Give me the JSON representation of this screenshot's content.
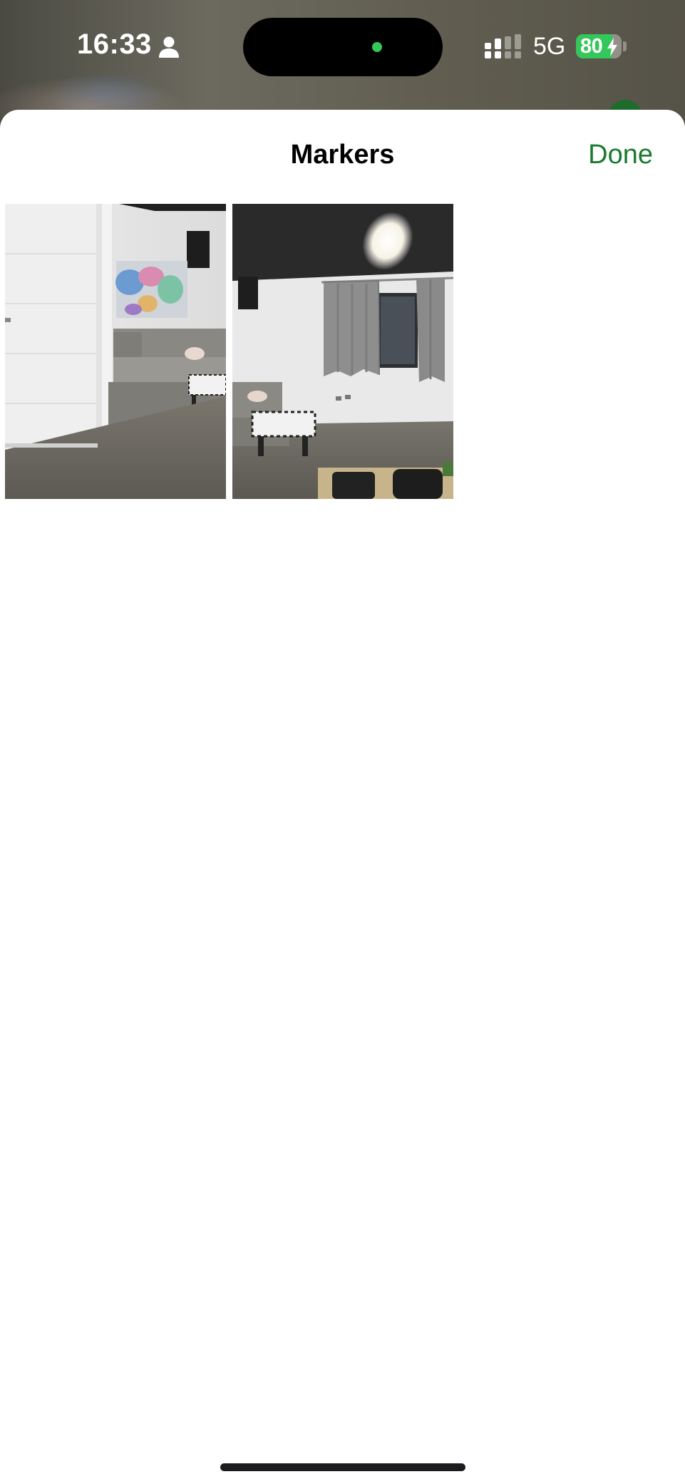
{
  "status_bar": {
    "time": "16:33",
    "network": "5G",
    "battery_percent": "80",
    "battery_level": 0.8,
    "charging": true,
    "icons": [
      "person-icon",
      "signal-icon",
      "bolt-icon"
    ]
  },
  "sheet": {
    "title": "Markers",
    "done_label": "Done",
    "accent_color": "#1a7a2f"
  },
  "markers": [
    {
      "name": "marker-thumbnail-1",
      "scene": "room-corner-door-sofa-map"
    },
    {
      "name": "marker-thumbnail-2",
      "scene": "room-window-curtains-sofa"
    }
  ]
}
